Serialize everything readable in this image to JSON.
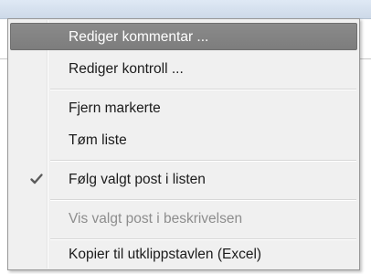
{
  "context_menu": {
    "items": [
      {
        "label": "Rediger kommentar ...",
        "state": "highlighted",
        "checked": false
      },
      {
        "label": "Rediger kontroll ...",
        "state": "normal",
        "checked": false
      },
      {
        "label": "Fjern markerte",
        "state": "normal",
        "checked": false
      },
      {
        "label": "Tøm liste",
        "state": "normal",
        "checked": false
      },
      {
        "label": "Følg valgt post i listen",
        "state": "normal",
        "checked": true
      },
      {
        "label": "Vis valgt post i beskrivelsen",
        "state": "disabled",
        "checked": false
      },
      {
        "label": "Kopier til utklippstavlen (Excel)",
        "state": "normal",
        "checked": false
      }
    ]
  },
  "colors": {
    "menu_background": "#f0f0f0",
    "highlight_background": "#828282",
    "highlight_text": "#ffffff",
    "normal_text": "#1b1b1b",
    "disabled_text": "#8d8d8d",
    "checkmark": "#5b5b5b"
  },
  "icons": {
    "checkmark": "check-icon"
  }
}
